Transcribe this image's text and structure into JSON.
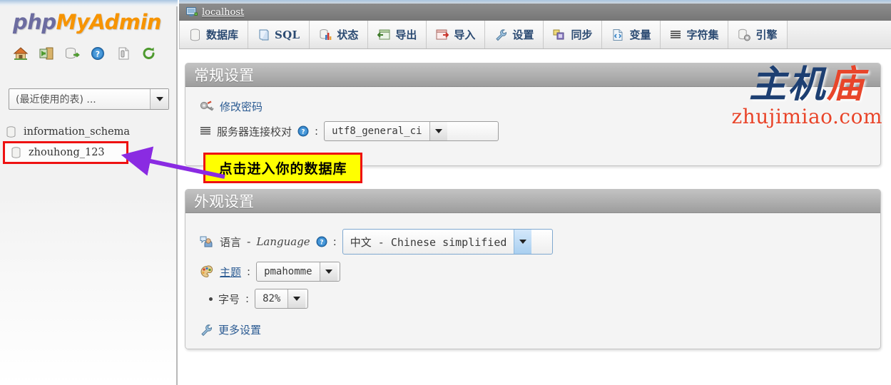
{
  "brand": {
    "php": "php",
    "myadmin": "MyAdmin"
  },
  "sidebar": {
    "icons": [
      {
        "name": "home-icon",
        "label": "主页"
      },
      {
        "name": "logout-icon",
        "label": "退出"
      },
      {
        "name": "query-window-icon",
        "label": "查询窗口"
      },
      {
        "name": "help-icon",
        "label": "帮助"
      },
      {
        "name": "documentation-icon",
        "label": "文档"
      },
      {
        "name": "reload-icon",
        "label": "重新载入"
      }
    ],
    "recent_select": {
      "value": "(最近使用的表) ...",
      "placeholder": "(最近使用的表) ..."
    },
    "databases": [
      {
        "name": "information_schema",
        "highlighted": false
      },
      {
        "name": "zhouhong_123",
        "highlighted": true
      }
    ]
  },
  "header": {
    "server_title": "localhost"
  },
  "tabs": [
    {
      "label": "数据库",
      "icon": "database-icon",
      "latin": false
    },
    {
      "label": "SQL",
      "icon": "sql-scroll-icon",
      "latin": true
    },
    {
      "label": "状态",
      "icon": "status-chart-icon",
      "latin": false
    },
    {
      "label": "导出",
      "icon": "export-icon",
      "latin": false
    },
    {
      "label": "导入",
      "icon": "import-icon",
      "latin": false
    },
    {
      "label": "设置",
      "icon": "wrench-icon",
      "latin": false
    },
    {
      "label": "同步",
      "icon": "sync-icon",
      "latin": false
    },
    {
      "label": "变量",
      "icon": "variables-icon",
      "latin": false
    },
    {
      "label": "字符集",
      "icon": "charset-icon",
      "latin": false
    },
    {
      "label": "引擎",
      "icon": "engines-icon",
      "latin": false
    }
  ],
  "general_panel": {
    "title": "常规设置",
    "change_password": {
      "label": "修改密码",
      "icon": "key-icon"
    },
    "collation": {
      "label": "服务器连接校对",
      "icon": "charset-lines-icon",
      "help_icon": "help-icon",
      "colon": ":",
      "value": "utf8_general_ci"
    }
  },
  "appearance_panel": {
    "title": "外观设置",
    "language": {
      "label": "语言 - Language",
      "label_cn": "语言",
      "dash": "-",
      "label_en": "Language",
      "icon": "language-user-icon",
      "help_icon": "help-icon",
      "colon": ":",
      "value": "中文 - Chinese simplified"
    },
    "theme": {
      "label": "主题",
      "icon": "palette-icon",
      "colon": ":",
      "value": "pmahomme"
    },
    "font_size": {
      "label": "字号",
      "colon": ":",
      "value": "82%"
    },
    "more_settings": {
      "label": "更多设置",
      "icon": "wrench-icon"
    }
  },
  "annotation": {
    "text": "点击进入你的数据库",
    "box_bg": "#ffff00",
    "box_border": "#ee1111",
    "arrow_color": "#8a2be2",
    "highlight_border": "#ee1111"
  },
  "watermark": {
    "chinese_dark": "主机",
    "chinese_red": "庙",
    "url": "zhujimiao.com",
    "color_dark": "#1d3f72",
    "color_red": "#e8452a"
  }
}
